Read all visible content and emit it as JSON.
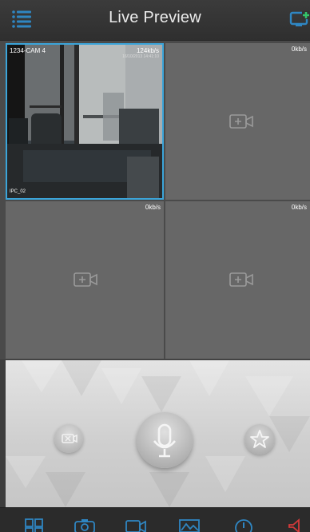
{
  "header": {
    "title": "Live Preview",
    "menu_icon": "list-menu-icon",
    "add_icon": "add-device-icon"
  },
  "grid": {
    "cells": [
      {
        "bitrate": "124kb/s",
        "camera_name": "1234-CAM 4",
        "timestamp": "16/10/2013 14:41:10",
        "channel": "IPC_02",
        "state": "live"
      },
      {
        "bitrate": "0kb/s",
        "state": "empty",
        "icon": "add-camera-icon"
      },
      {
        "bitrate": "0kb/s",
        "state": "empty",
        "icon": "add-camera-icon"
      },
      {
        "bitrate": "0kb/s",
        "state": "empty",
        "icon": "add-camera-icon"
      }
    ]
  },
  "controls": {
    "snapshot_icon": "snapshot-off-icon",
    "talk_icon": "microphone-icon",
    "favorite_icon": "star-icon"
  },
  "tabbar": {
    "icons": [
      "layout-grid-icon",
      "camera-icon",
      "record-icon",
      "image-icon",
      "info-icon",
      "sound-icon"
    ]
  },
  "colors": {
    "accent": "#3ba4d9",
    "icon": "#2f86c2",
    "header_bg": "#333333",
    "cell_bg": "#676767",
    "sound_off": "#d43a3a"
  }
}
